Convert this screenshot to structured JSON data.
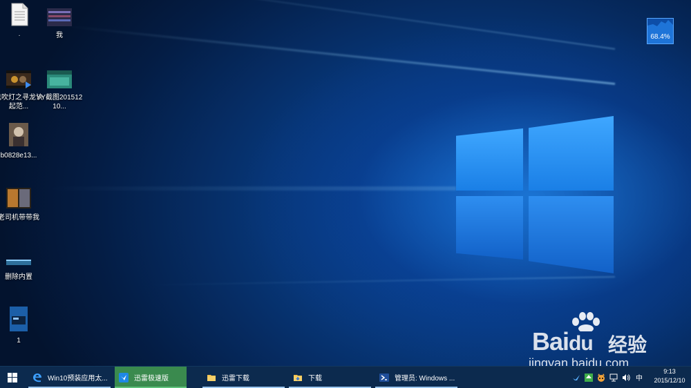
{
  "desktop": {
    "icons": [
      {
        "label": "·"
      },
      {
        "label": "我"
      },
      {
        "label": "鬼吹灯之寻龙诀 起范..."
      },
      {
        "label": "YY截图20151210..."
      },
      {
        "label": "b0828e13..."
      },
      {
        "label": "老司机带带我"
      },
      {
        "label": "删除内置"
      },
      {
        "label": "1"
      }
    ],
    "perf_widget": {
      "value": "68.4%"
    }
  },
  "watermark": {
    "logo": "Bai",
    "logo_tail": "du",
    "cn": "经验",
    "url": "jingyan.baidu.com"
  },
  "taskbar": {
    "tasks": [
      {
        "label": "Win10预装应用太...",
        "icon": "edge-icon"
      },
      {
        "label": "迅雷极速版",
        "icon": "thunder-icon",
        "active": true
      },
      {
        "label": "迅雷下载",
        "icon": "folder-icon"
      },
      {
        "label": "下载",
        "icon": "folder-icon"
      },
      {
        "label": "管理员: Windows ...",
        "icon": "powershell-icon"
      }
    ],
    "tray": {
      "ime": "中"
    },
    "clock": {
      "time": "9:13",
      "date": "2015/12/10"
    }
  }
}
